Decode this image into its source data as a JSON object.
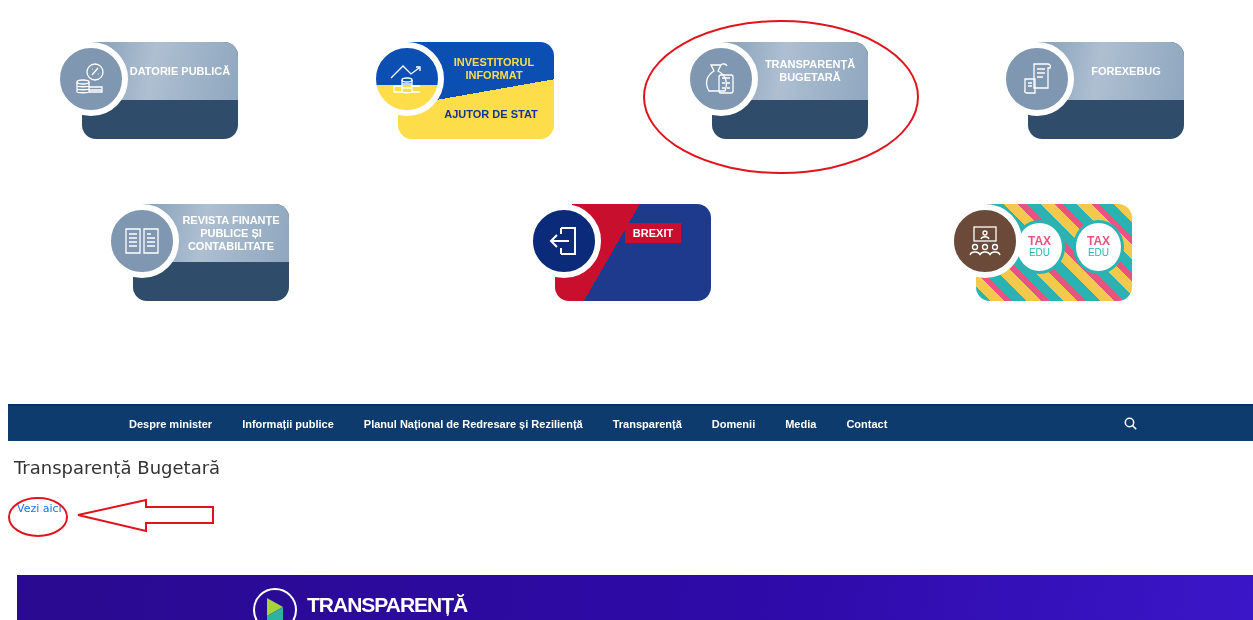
{
  "tiles_row_1": [
    {
      "kind": "standard",
      "labels": [
        "DATORIE PUBLICĂ"
      ]
    },
    {
      "kind": "investitor",
      "labels": [
        "INVESTITORUL INFORMAT",
        "AJUTOR DE STAT"
      ]
    },
    {
      "kind": "standard",
      "labels": [
        "TRANSPARENȚĂ BUGETARĂ"
      ]
    },
    {
      "kind": "standard",
      "labels": [
        "FOREXEBUG"
      ]
    }
  ],
  "tiles_row_2": [
    {
      "kind": "standard",
      "labels": [
        "REVISTA FINANȚE PUBLICE ȘI CONTABILITATE"
      ]
    },
    {
      "kind": "brexit",
      "labels": [
        "BREXIT"
      ]
    },
    {
      "kind": "taxedu",
      "labels": [
        "TAX",
        "EDU",
        "TAX",
        "EDU"
      ]
    }
  ],
  "nav": {
    "items": [
      "Despre minister",
      "Informații publice",
      "Planul Național de Redresare și Reziliență",
      "Transparență",
      "Domenii",
      "Media",
      "Contact"
    ]
  },
  "page_title": "Transparență Bugetară",
  "link": "Vezi aici",
  "banner": {
    "title": "TRANSPARENȚĂ"
  }
}
